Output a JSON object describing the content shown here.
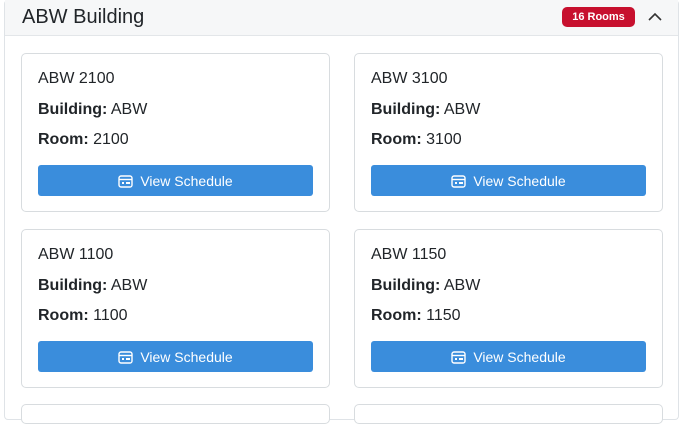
{
  "section": {
    "title": "ABW Building",
    "badge": "16 Rooms",
    "toggle_icon": "chevron-up-icon"
  },
  "labels": {
    "building": "Building:",
    "room": "Room:",
    "view_schedule": "View Schedule",
    "button_icon": "calendar-icon"
  },
  "rooms": [
    {
      "name": "ABW 2100",
      "building": "ABW",
      "room": "2100"
    },
    {
      "name": "ABW 3100",
      "building": "ABW",
      "room": "3100"
    },
    {
      "name": "ABW 1100",
      "building": "ABW",
      "room": "1100"
    },
    {
      "name": "ABW 1150",
      "building": "ABW",
      "room": "1150"
    }
  ]
}
